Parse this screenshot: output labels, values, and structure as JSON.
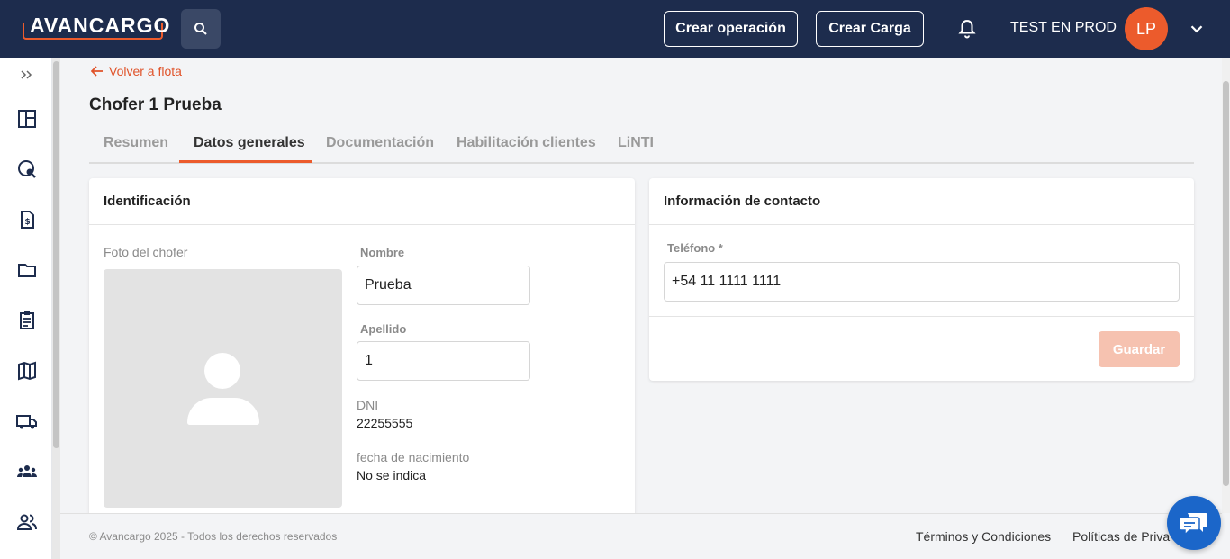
{
  "header": {
    "logo": "AVANCARGO",
    "search_icon": "search-icon",
    "crear_operacion": "Crear operación",
    "crear_carga": "Crear Carga",
    "bell_icon": "bell-icon",
    "user_name": "TEST EN PROD",
    "avatar_initials": "LP",
    "menu_icon": "chevron-down-icon",
    "colors": {
      "bar": "#1d2c4d",
      "accent": "#ec5b2c"
    }
  },
  "sidebar": {
    "expand_icon": "double-chevron-right-icon",
    "items": [
      {
        "icon": "dashboard-icon"
      },
      {
        "icon": "globe-search-icon"
      },
      {
        "icon": "invoice-icon"
      },
      {
        "icon": "folder-icon"
      },
      {
        "icon": "clipboard-icon"
      },
      {
        "icon": "map-icon"
      },
      {
        "icon": "truck-icon"
      },
      {
        "icon": "group-icon"
      },
      {
        "icon": "users-icon"
      }
    ]
  },
  "page": {
    "back_link": "Volver a flota",
    "title": "Chofer 1 Prueba",
    "tabs": [
      {
        "label": "Resumen",
        "active": false
      },
      {
        "label": "Datos generales",
        "active": true
      },
      {
        "label": "Documentación",
        "active": false
      },
      {
        "label": "Habilitación clientes",
        "active": false
      },
      {
        "label": "LiNTI",
        "active": false
      }
    ]
  },
  "identificacion": {
    "title": "Identificación",
    "foto_label": "Foto del chofer",
    "nombre_label": "Nombre",
    "nombre_value": "Prueba",
    "apellido_label": "Apellido",
    "apellido_value": "1",
    "dni_label": "DNI",
    "dni_value": "22255555",
    "fecha_label": "fecha de nacimiento",
    "fecha_value": "No se indica"
  },
  "contacto": {
    "title": "Información de contacto",
    "telefono_label": "Teléfono *",
    "telefono_value": "+54 11 1111 1111",
    "guardar_label": "Guardar"
  },
  "footer": {
    "copyright": "© Avancargo 2025 - Todos los derechos reservados",
    "terminos": "Términos y Condiciones",
    "politicas": "Políticas de Priva"
  },
  "chat_icon": "chat-icon"
}
